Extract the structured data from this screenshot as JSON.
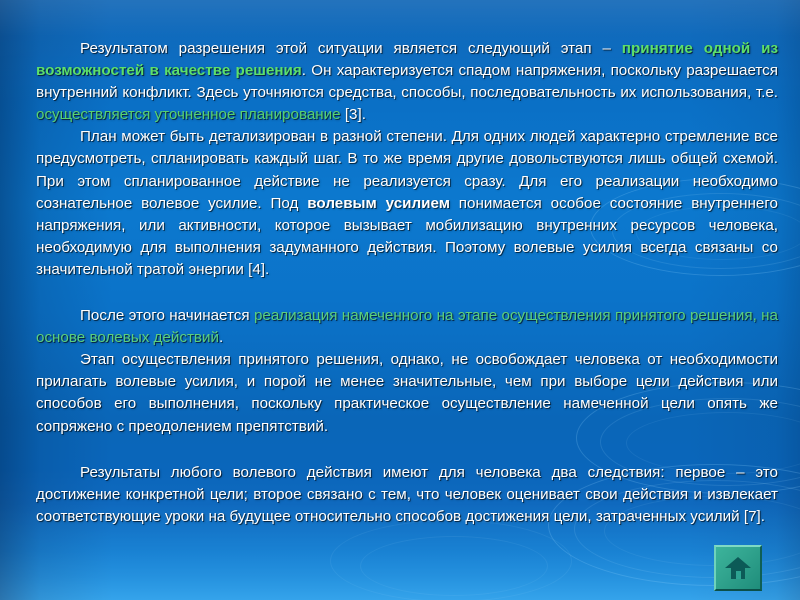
{
  "slide": {
    "background_color": "#0b6fc2",
    "accent_green_bold": "#5de06a",
    "accent_green": "#58d070",
    "text_color": "#ffffff"
  },
  "paragraphs": [
    {
      "id": "para-1",
      "runs": [
        {
          "style": "normal",
          "text": "Результатом разрешения этой ситуации является следующий этап – "
        },
        {
          "style": "hl-bold",
          "text": "принятие одной из возможностей в качестве решения"
        },
        {
          "style": "normal",
          "text": ". Он характеризуется спадом напряжения, поскольку разрешается внутренний конфликт. Здесь уточняются средства, способы, последовательность их использования, т.е. "
        },
        {
          "style": "hl-plain",
          "text": "осуществляется уточненное планирование"
        },
        {
          "style": "normal",
          "text": " [3]."
        }
      ]
    },
    {
      "id": "para-2",
      "runs": [
        {
          "style": "normal",
          "text": "План может быть детализирован в разной степени. Для одних людей характерно стремление все предусмотреть, спланировать каждый шаг. В то же время другие довольствуются лишь общей схемой. При этом спланированное действие не реализуется сразу. Для его реализации необходимо сознательное волевое усилие. Под "
        },
        {
          "style": "wht-bold",
          "text": "волевым усилием"
        },
        {
          "style": "normal",
          "text": " понимается особое состояние внутреннего напряжения, или активности, которое вызывает мобилизацию внутренних ресурсов человека, необходимую для выполнения задуманного действия. Поэтому волевые усилия всегда связаны со значительной тратой энергии [4]."
        }
      ]
    },
    {
      "id": "para-3",
      "runs": [
        {
          "style": "normal",
          "text": "После этого начинается "
        },
        {
          "style": "hl-mid",
          "text": "реализация намеченного на этапе осуществления принятого решения, на основе волевых действий"
        },
        {
          "style": "normal",
          "text": "."
        }
      ]
    },
    {
      "id": "para-4",
      "runs": [
        {
          "style": "normal",
          "text": "Этап осуществления принятого решения, однако, не освобождает человека от необходимости прилагать волевые усилия, и порой не менее значительные, чем при выборе цели действия или способов его выполнения, поскольку практическое осуществление намеченной цели опять же сопряжено с преодолением препятствий."
        }
      ]
    },
    {
      "id": "para-5",
      "runs": [
        {
          "style": "normal",
          "text": "Результаты любого волевого действия имеют для человека два следствия: первое – это достижение конкретной цели; второе связано с тем, что человек оценивает свои действия и извлекает соответствующие уроки на будущее относительно способов достижения цели, затраченных усилий [7]."
        }
      ]
    }
  ],
  "home_button": {
    "label": "",
    "icon": "home-icon",
    "color": "#2da391"
  }
}
